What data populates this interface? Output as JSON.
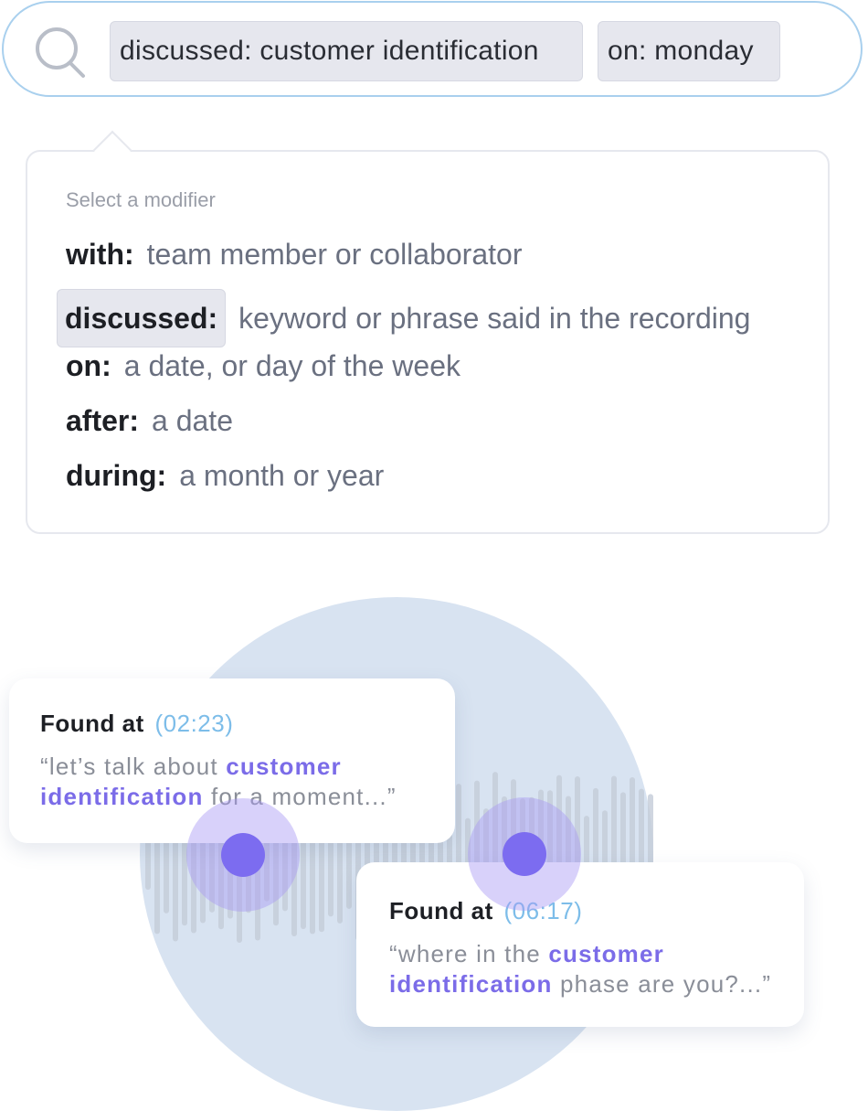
{
  "search": {
    "chips": [
      "discussed: customer identification",
      "on: monday"
    ]
  },
  "dropdown": {
    "title": "Select a modifier",
    "items": [
      {
        "key": "with:",
        "desc": "team member or collaborator"
      },
      {
        "key": "discussed:",
        "desc": "keyword or phrase said in the recording",
        "selected": true
      },
      {
        "key": "on:",
        "desc": "a date, or day of the week"
      },
      {
        "key": "after:",
        "desc": "a date"
      },
      {
        "key": "during:",
        "desc": "a month or year"
      }
    ]
  },
  "results": [
    {
      "label": "Found at",
      "time": "(02:23)",
      "quote_before": "“let’s talk about ",
      "quote_highlight": "customer identification",
      "quote_after": " for a moment...”"
    },
    {
      "label": "Found at",
      "time": "(06:17)",
      "quote_before": "“where  in the ",
      "quote_highlight": "customer identification",
      "quote_after": " phase are you?...”"
    }
  ],
  "colors": {
    "accent": "#7b6ce8",
    "timestamp": "#7dbde9",
    "search_border": "#a9d0ee",
    "chip_bg": "#e6e7ee",
    "circle_bg": "#d8e3f1"
  }
}
